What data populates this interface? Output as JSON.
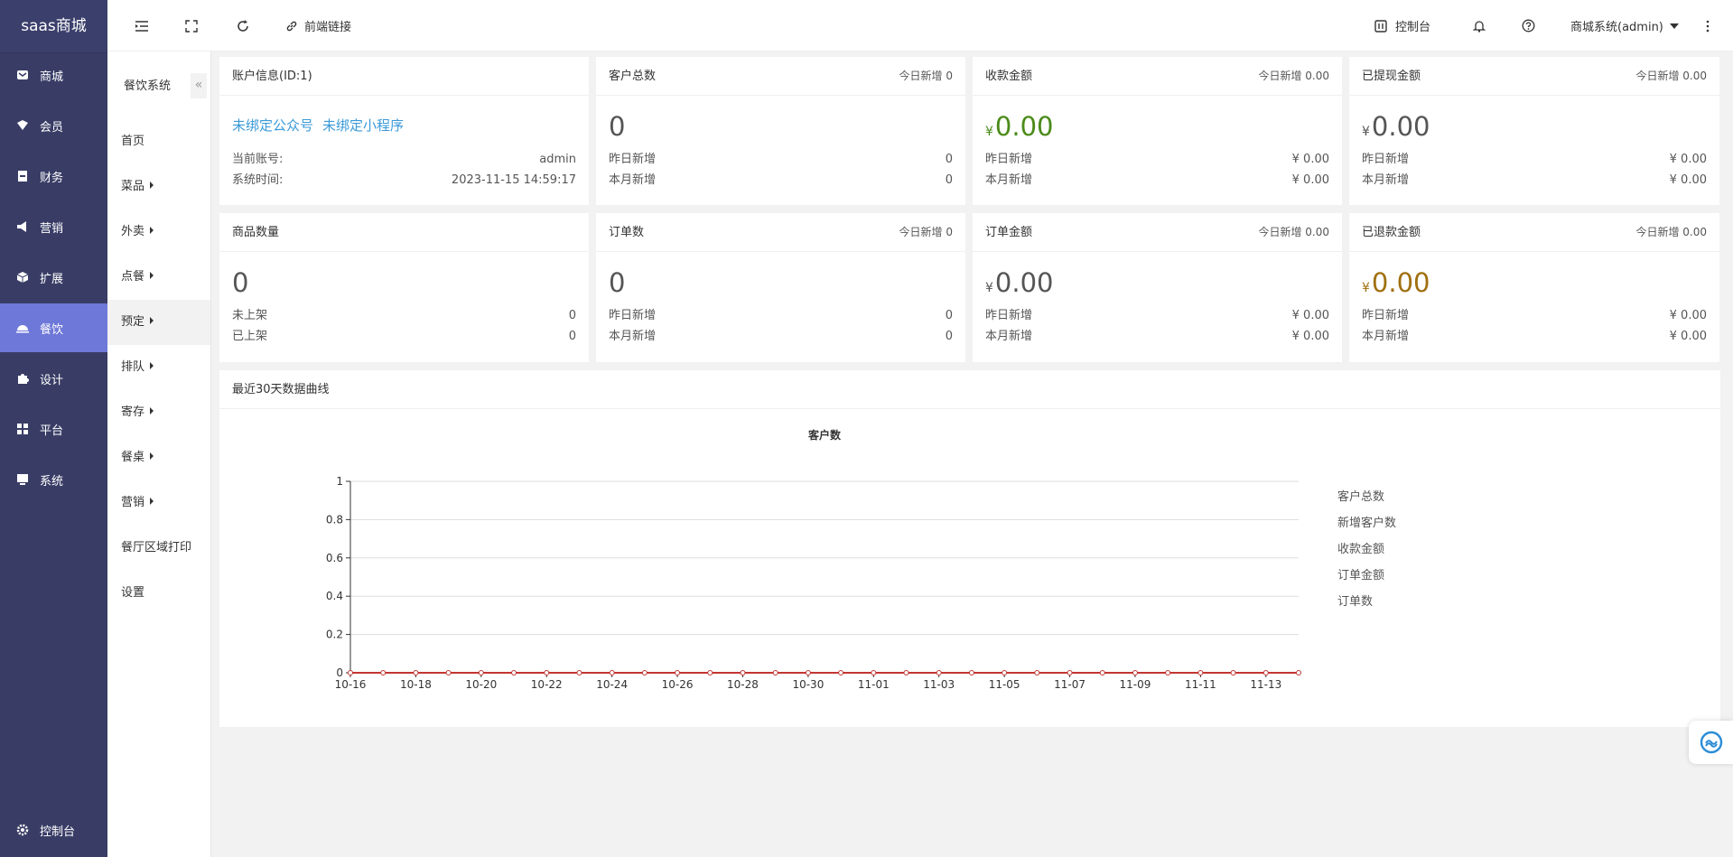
{
  "sidebar": {
    "brand": "saas商城",
    "items": [
      {
        "label": "商城",
        "icon": "mail-icon"
      },
      {
        "label": "会员",
        "icon": "tag-icon"
      },
      {
        "label": "财务",
        "icon": "finance-icon"
      },
      {
        "label": "营销",
        "icon": "megaphone-icon"
      },
      {
        "label": "扩展",
        "icon": "cube-icon"
      },
      {
        "label": "餐饮",
        "icon": "dish-icon"
      },
      {
        "label": "设计",
        "icon": "puzzle-icon"
      },
      {
        "label": "平台",
        "icon": "grid-icon"
      },
      {
        "label": "系统",
        "icon": "monitor-icon"
      }
    ],
    "footer": "控制台"
  },
  "subnav": {
    "title": "餐饮系统",
    "collapse": "«",
    "items": [
      "首页",
      "菜品",
      "外卖",
      "点餐",
      "预定",
      "排队",
      "寄存",
      "餐桌",
      "营销",
      "餐厅区域打印",
      "设置"
    ]
  },
  "header": {
    "front_link": "前端链接",
    "console": "控制台",
    "user": "商城系统(admin)"
  },
  "account": {
    "title": "账户信息(ID:1)",
    "link1": "未绑定公众号",
    "link2": "未绑定小程序",
    "account_label": "当前账号:",
    "account_value": "admin",
    "time_label": "系统时间:",
    "time_value": "2023-11-15 14:59:17"
  },
  "stats": {
    "yen": "¥",
    "yesterday": "昨日新增",
    "month": "本月新增",
    "customers": {
      "title": "客户总数",
      "today": "今日新增 0",
      "value": "0",
      "y": "0",
      "m": "0"
    },
    "revenue": {
      "title": "收款金额",
      "today": "今日新增 0.00",
      "value": "0.00",
      "y": "¥ 0.00",
      "m": "¥ 0.00"
    },
    "withdrawn": {
      "title": "已提现金额",
      "today": "今日新增 0.00",
      "value": "0.00",
      "y": "¥ 0.00",
      "m": "¥ 0.00"
    },
    "products": {
      "title": "商品数量",
      "value": "0",
      "off_label": "未上架",
      "off": "0",
      "on_label": "已上架",
      "on": "0"
    },
    "orders": {
      "title": "订单数",
      "today": "今日新增 0",
      "value": "0",
      "y": "0",
      "m": "0"
    },
    "order_amount": {
      "title": "订单金额",
      "today": "今日新增 0.00",
      "value": "0.00",
      "y": "¥ 0.00",
      "m": "¥ 0.00"
    },
    "refund": {
      "title": "已退款金额",
      "today": "今日新增 0.00",
      "value": "0.00",
      "y": "¥ 0.00",
      "m": "¥ 0.00"
    }
  },
  "chart_section": {
    "title": "最近30天数据曲线"
  },
  "chart_data": {
    "type": "line",
    "title": "客户数",
    "x": [
      "10-16",
      "10-17",
      "10-18",
      "10-19",
      "10-20",
      "10-21",
      "10-22",
      "10-23",
      "10-24",
      "10-25",
      "10-26",
      "10-27",
      "10-28",
      "10-29",
      "10-30",
      "10-31",
      "11-01",
      "11-02",
      "11-03",
      "11-04",
      "11-05",
      "11-06",
      "11-07",
      "11-08",
      "11-09",
      "11-10",
      "11-11",
      "11-12",
      "11-13",
      "11-14"
    ],
    "x_tick_labels": [
      "10-16",
      "10-18",
      "10-20",
      "10-22",
      "10-24",
      "10-26",
      "10-28",
      "10-30",
      "11-01",
      "11-03",
      "11-05",
      "11-07",
      "11-09",
      "11-11",
      "11-13"
    ],
    "ylim": [
      0,
      1
    ],
    "y_ticks": [
      "0",
      "0.2",
      "0.4",
      "0.6",
      "0.8",
      "1"
    ],
    "legend": [
      "客户总数",
      "新增客户数",
      "收款金额",
      "订单金额",
      "订单数"
    ],
    "legend_position": "right",
    "series": [
      {
        "name": "客户数",
        "values": [
          0,
          0,
          0,
          0,
          0,
          0,
          0,
          0,
          0,
          0,
          0,
          0,
          0,
          0,
          0,
          0,
          0,
          0,
          0,
          0,
          0,
          0,
          0,
          0,
          0,
          0,
          0,
          0,
          0,
          0
        ]
      }
    ],
    "colors": {
      "line": "#c23531",
      "grid": "#dddddd"
    },
    "grid": true
  }
}
